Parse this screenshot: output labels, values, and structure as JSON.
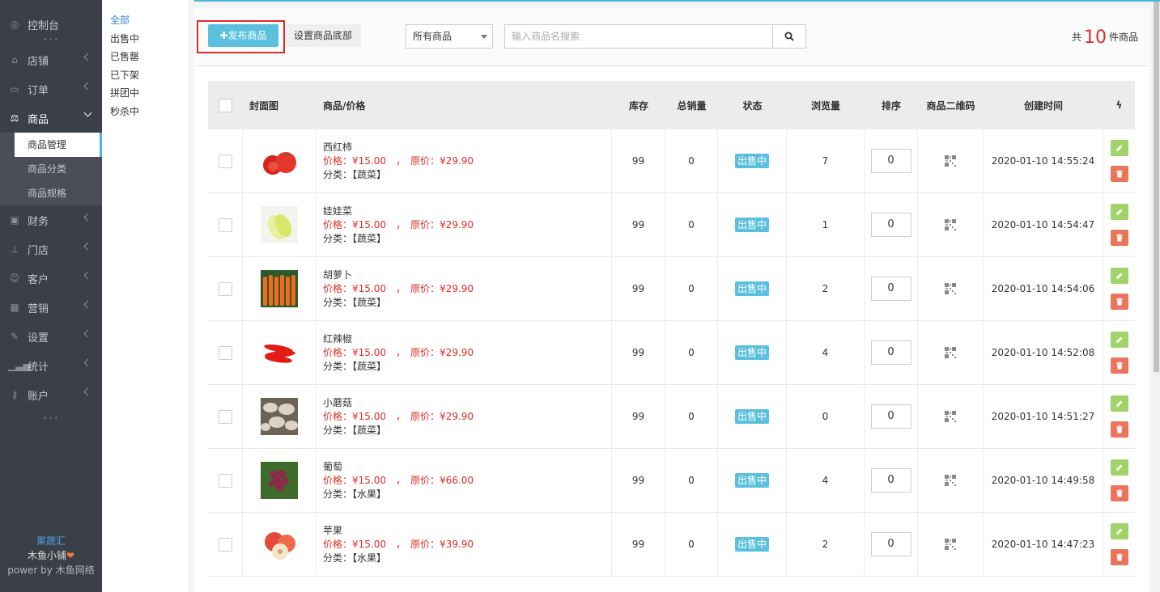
{
  "sidebar": {
    "items": [
      {
        "label": "控制台",
        "icon": "dashboard-icon"
      },
      {
        "label": "店铺",
        "icon": "shop-icon"
      },
      {
        "label": "订单",
        "icon": "order-icon"
      },
      {
        "label": "商品",
        "icon": "scale-icon"
      },
      {
        "label": "财务",
        "icon": "money-icon"
      },
      {
        "label": "门店",
        "icon": "sitemap-icon"
      },
      {
        "label": "客户",
        "icon": "users-icon"
      },
      {
        "label": "营销",
        "icon": "grid-icon"
      },
      {
        "label": "设置",
        "icon": "wrench-icon"
      },
      {
        "label": "统计",
        "icon": "signal-icon"
      },
      {
        "label": "账户",
        "icon": "key-icon"
      }
    ],
    "sub_items": [
      "商品管理",
      "商品分类",
      "商品规格"
    ],
    "footer": {
      "line1": "果蔬汇",
      "line2": "木鱼小铺",
      "line3": "power by 木鱼网络"
    }
  },
  "subnav": [
    "全部",
    "出售中",
    "已售罄",
    "已下架",
    "拼团中",
    "秒杀中"
  ],
  "toolbar": {
    "publish_label": "发布商品",
    "set_bottom_label": "设置商品底部",
    "filter_value": "所有商品",
    "search_placeholder": "输入商品名搜索",
    "count_prefix": "共",
    "count_num": "10",
    "count_suffix": "件商品"
  },
  "table": {
    "headers": [
      "封面图",
      "商品/价格",
      "库存",
      "总销量",
      "状态",
      "浏览量",
      "排序",
      "商品二维码",
      "创建时间"
    ],
    "price_label": "价格：",
    "orig_label": "原价：",
    "cat_label": "分类：",
    "rows": [
      {
        "name": "西红柿",
        "price": "¥15.00",
        "orig": "¥29.90",
        "cat": "【蔬菜】",
        "stock": "99",
        "sales": "0",
        "status": "出售中",
        "views": "7",
        "sort": "0",
        "time": "2020-01-10 14:55:24"
      },
      {
        "name": "娃娃菜",
        "price": "¥15.00",
        "orig": "¥29.90",
        "cat": "【蔬菜】",
        "stock": "99",
        "sales": "0",
        "status": "出售中",
        "views": "1",
        "sort": "0",
        "time": "2020-01-10 14:54:47"
      },
      {
        "name": "胡萝卜",
        "price": "¥15.00",
        "orig": "¥29.90",
        "cat": "【蔬菜】",
        "stock": "99",
        "sales": "0",
        "status": "出售中",
        "views": "2",
        "sort": "0",
        "time": "2020-01-10 14:54:06"
      },
      {
        "name": "红辣椒",
        "price": "¥15.00",
        "orig": "¥29.90",
        "cat": "【蔬菜】",
        "stock": "99",
        "sales": "0",
        "status": "出售中",
        "views": "4",
        "sort": "0",
        "time": "2020-01-10 14:52:08"
      },
      {
        "name": "小蘑菇",
        "price": "¥15.00",
        "orig": "¥29.90",
        "cat": "【蔬菜】",
        "stock": "99",
        "sales": "0",
        "status": "出售中",
        "views": "0",
        "sort": "0",
        "time": "2020-01-10 14:51:27"
      },
      {
        "name": "葡萄",
        "price": "¥15.00",
        "orig": "¥66.00",
        "cat": "【水果】",
        "stock": "99",
        "sales": "0",
        "status": "出售中",
        "views": "4",
        "sort": "0",
        "time": "2020-01-10 14:49:58"
      },
      {
        "name": "苹果",
        "price": "¥15.00",
        "orig": "¥39.90",
        "cat": "【水果】",
        "stock": "99",
        "sales": "0",
        "status": "出售中",
        "views": "2",
        "sort": "0",
        "time": "2020-01-10 14:47:23"
      }
    ]
  },
  "colors": {
    "accent": "#5bc0de",
    "price": "#e32a2a",
    "edit": "#a0d468",
    "delete": "#e9765a",
    "sidebar": "#3b3f48"
  }
}
